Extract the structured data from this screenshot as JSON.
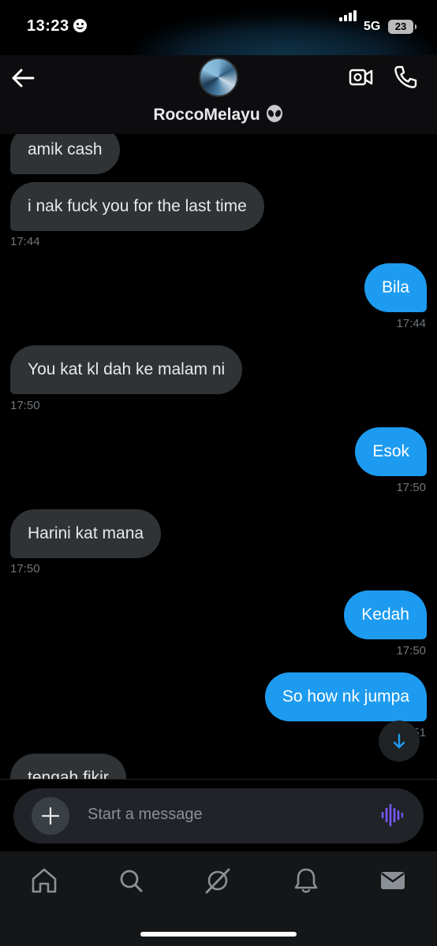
{
  "status": {
    "time": "13:23",
    "network": "5G",
    "battery": "23"
  },
  "header": {
    "contact_name": "RoccoMelayu"
  },
  "messages": [
    {
      "dir": "in",
      "text": "amik cash"
    },
    {
      "dir": "in",
      "text": "i nak fuck you for the last time",
      "time": "17:44"
    },
    {
      "dir": "out",
      "text": "Bila",
      "time": "17:44"
    },
    {
      "dir": "in",
      "text": "You kat kl dah ke malam ni",
      "time": "17:50"
    },
    {
      "dir": "out",
      "text": "Esok",
      "time": "17:50"
    },
    {
      "dir": "in",
      "text": "Harini kat mana",
      "time": "17:50"
    },
    {
      "dir": "out",
      "text": "Kedah",
      "time": "17:50"
    },
    {
      "dir": "out",
      "text": "So how nk jumpa",
      "time": "17:51"
    },
    {
      "dir": "in",
      "text": "tengah fikir"
    }
  ],
  "composer": {
    "placeholder": "Start a message"
  },
  "icons": {
    "back": "back-arrow-icon",
    "video": "video-call-icon",
    "phone": "phone-call-icon",
    "scroll": "arrow-down-icon",
    "plus": "plus-icon",
    "voice": "voice-waveform-icon",
    "tabs": [
      "home-icon",
      "search-icon",
      "grok-icon",
      "notifications-icon",
      "messages-icon"
    ]
  },
  "colors": {
    "accent": "#1d9bf0",
    "incoming_bubble": "#2f3336",
    "voice": "#7856ff"
  }
}
